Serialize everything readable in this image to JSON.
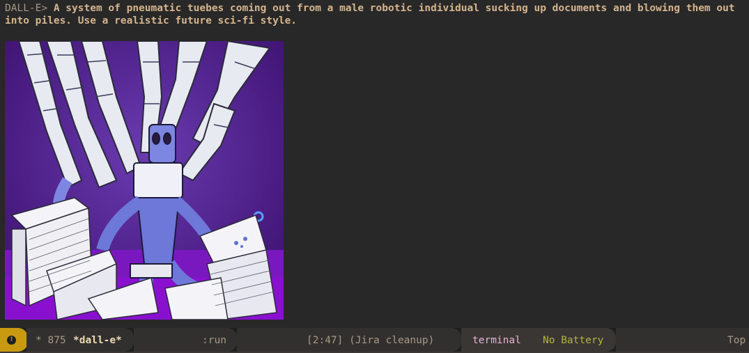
{
  "prompt": {
    "label": "DALL-E>",
    "text": "A system of pneumatic tuebes coming out from a male robotic individual sucking up documents and blowing them out into piles. Use a realistic future sci-fi style."
  },
  "modeline": {
    "status_badge": "!",
    "buffer_state": "* 875",
    "buffer_name": "*dall-e*",
    "command": ":run",
    "clock": "[2:47] (Jira cleanup)",
    "mode": "terminal",
    "battery": "No Battery",
    "position": "Top"
  },
  "colors": {
    "background": "#282828",
    "prompt_text": "#d5b58f",
    "modeline_bg": "#32302f",
    "badge": "#c99a10",
    "mode_color": "#d3869b",
    "battery_color": "#b8bb26"
  }
}
